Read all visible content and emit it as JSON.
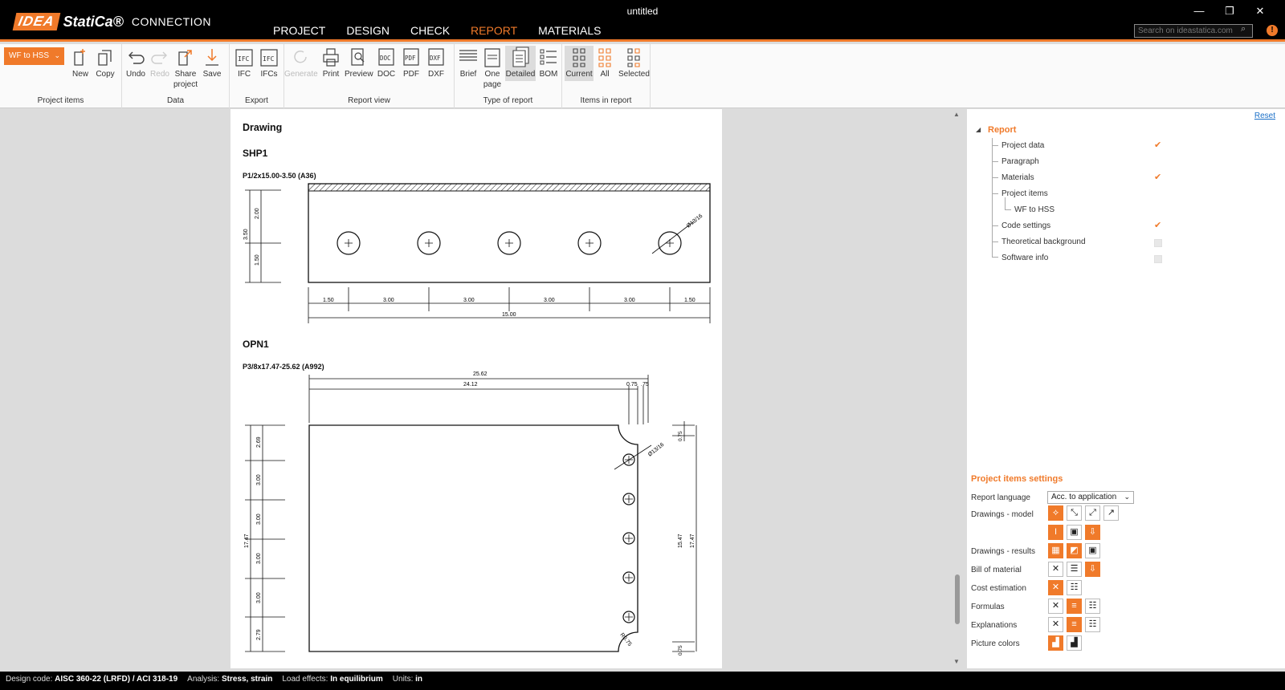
{
  "window": {
    "title": "untitled",
    "controls": [
      "—",
      "❐",
      "✕"
    ]
  },
  "brand": {
    "idea": "IDEA",
    "statica": "StatiCa®",
    "product": "CONNECTION"
  },
  "menu": [
    "PROJECT",
    "DESIGN",
    "CHECK",
    "REPORT",
    "MATERIALS"
  ],
  "menu_active": "REPORT",
  "search": {
    "placeholder": "Search on ideastatica.com"
  },
  "ribbon": {
    "project_dropdown": "WF to HSS",
    "groups": {
      "project_items": {
        "title": "Project items",
        "new": "New",
        "copy": "Copy"
      },
      "data": {
        "title": "Data",
        "undo": "Undo",
        "redo": "Redo",
        "share1": "Share",
        "share2": "project",
        "save": "Save"
      },
      "export": {
        "title": "Export",
        "ifc": "IFC",
        "ifcs": "IFCs"
      },
      "report_view": {
        "title": "Report view",
        "generate": "Generate",
        "print": "Print",
        "preview": "Preview",
        "doc": "DOC",
        "pdf": "PDF",
        "dxf": "DXF"
      },
      "type_of_report": {
        "title": "Type of report",
        "brief": "Brief",
        "onepage1": "One",
        "onepage2": "page",
        "detailed": "Detailed",
        "bom": "BOM"
      },
      "items_in_report": {
        "title": "Items in report",
        "current": "Current",
        "all": "All",
        "selected": "Selected"
      }
    }
  },
  "document": {
    "heading": "Drawing",
    "parts": [
      {
        "name": "SHP1",
        "desc": "P1/2x15.00-3.50 (A36)"
      },
      {
        "name": "OPN1",
        "desc": "P3/8x17.47-25.62 (A992)"
      }
    ],
    "shp1_dims": {
      "h_total": "3.50",
      "h_top": "2.00",
      "h_bot": "1.50",
      "spacings": [
        "1.50",
        "3.00",
        "3.00",
        "3.00",
        "3.00",
        "1.50"
      ],
      "length": "15.00",
      "hole": "Ø13/16"
    },
    "opn1_dims": {
      "width": "25.62",
      "w1": "24.12",
      "w2": "0.75",
      "w3": ".75",
      "h_total": "17.47",
      "v_left": [
        "2.69",
        "3.00",
        "3.00",
        "3.00",
        "3.00",
        "2.79"
      ],
      "right_inner": "15.47",
      "right_outer": "17.47",
      "top_small": "0.75",
      "bot_small": "0.75",
      "hole": "Ø13/16",
      "radius": "R0.75"
    }
  },
  "report_tree": {
    "reset": "Reset",
    "root": "Report",
    "items": [
      {
        "label": "Project data",
        "checked": true
      },
      {
        "label": "Paragraph",
        "checked": null
      },
      {
        "label": "Materials",
        "checked": true
      },
      {
        "label": "Project items",
        "checked": null
      },
      {
        "label": "WF to HSS",
        "checked": null
      },
      {
        "label": "Code settings",
        "checked": true
      },
      {
        "label": "Theoretical background",
        "checked": false
      },
      {
        "label": "Software info",
        "checked": false
      }
    ]
  },
  "settings": {
    "title": "Project items settings",
    "report_language_label": "Report language",
    "report_language_value": "Acc. to application",
    "drawings_model": "Drawings - model",
    "drawings_results": "Drawings - results",
    "bill_of_material": "Bill of material",
    "cost_estimation": "Cost estimation",
    "formulas": "Formulas",
    "explanations": "Explanations",
    "picture_colors": "Picture colors"
  },
  "statusbar": {
    "design_code_label": "Design code:",
    "design_code": "AISC 360-22 (LRFD) / ACI 318-19",
    "analysis_label": "Analysis:",
    "analysis": "Stress, strain",
    "load_effects_label": "Load effects:",
    "load_effects": "In equilibrium",
    "units_label": "Units:",
    "units": "in"
  },
  "colors": {
    "accent": "#f07a2a",
    "titlebar": "#000000",
    "link": "#1a6fc7"
  }
}
